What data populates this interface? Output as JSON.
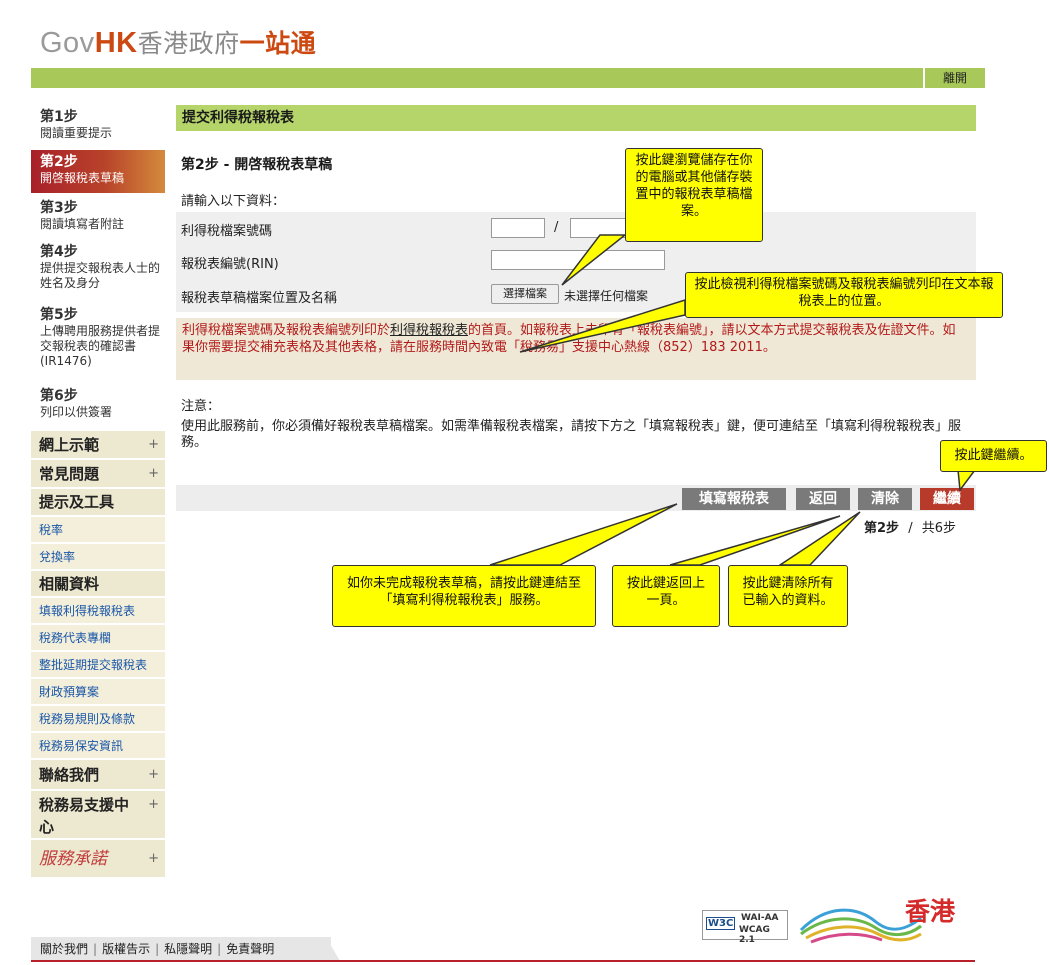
{
  "header": {
    "logo_gov": "Gov",
    "logo_hk": "HK",
    "logo_cn1": "香港政府",
    "logo_cn2": "一站通",
    "logout": "離開"
  },
  "sidebar": {
    "steps": [
      {
        "num": "第1步",
        "label": "閱讀重要提示"
      },
      {
        "num": "第2步",
        "label": "開啓報稅表草稿"
      },
      {
        "num": "第3步",
        "label": "閱讀填寫者附註"
      },
      {
        "num": "第4步",
        "label": "提供提交報稅表人士的姓名及身分"
      },
      {
        "num": "第5步",
        "label": "上傳聘用服務提供者提交報稅表的確認書 (IR1476)"
      },
      {
        "num": "第6步",
        "label": "列印以供簽署"
      }
    ],
    "menu": [
      {
        "label": "網上示範",
        "type": "big",
        "plus": "+"
      },
      {
        "label": "常見問題",
        "type": "big",
        "plus": "+"
      },
      {
        "label": "提示及工具",
        "type": "big",
        "plus": ""
      },
      {
        "label": "稅率",
        "type": "small",
        "plus": ""
      },
      {
        "label": "兌換率",
        "type": "small",
        "plus": ""
      },
      {
        "label": "相關資料",
        "type": "big",
        "plus": ""
      },
      {
        "label": "填報利得稅報稅表",
        "type": "small",
        "plus": ""
      },
      {
        "label": "稅務代表專欄",
        "type": "small",
        "plus": ""
      },
      {
        "label": "整批延期提交報稅表",
        "type": "small",
        "plus": ""
      },
      {
        "label": "財政預算案",
        "type": "small",
        "plus": ""
      },
      {
        "label": "稅務易規則及條款",
        "type": "small",
        "plus": ""
      },
      {
        "label": "稅務易保安資訊",
        "type": "small",
        "plus": ""
      },
      {
        "label": "聯絡我們",
        "type": "big",
        "plus": "+"
      },
      {
        "label": "稅務易支援中心",
        "type": "big",
        "plus": "+"
      },
      {
        "label": "服務承諾",
        "type": "brand",
        "plus": "+"
      }
    ]
  },
  "main": {
    "section_title": "提交利得稅報稅表",
    "sub_title": "第2步 - 開啓報稅表草稿",
    "intro": "請輸入以下資料：",
    "fields": {
      "file_no_label": "利得稅檔案號碼",
      "slash": "/",
      "rin_label": "報稅表編號(RIN)",
      "draft_label": "報稅表草稿檔案位置及名稱",
      "choose_file": "選擇檔案",
      "no_file": "未選擇任何檔案"
    },
    "notice_pre": "利得稅檔案號碼及報稅表編號列印於",
    "notice_link": "利得稅報稅表",
    "notice_post": "的首頁。如報稅表上未印有「報稅表編號」，請以文本方式提交報稅表及佐證文件。如果你需要提交補充表格及其他表格，請在服務時間內致電「稅務易」支援中心熱線（852）183 2011。",
    "notes_heading": "注意：",
    "notes_text": "使用此服務前，你必須備好報稅表草稿檔案。如需準備報稅表檔案，請按下方之「填寫報稅表」鍵，便可連結至「填寫利得稅報稅表」服務。",
    "buttons": {
      "fill": "填寫報稅表",
      "back": "返回",
      "clear": "清除",
      "continue": "繼續"
    },
    "pager_current": "第2步",
    "pager_sep": "/",
    "pager_total": "共6步"
  },
  "callouts": {
    "browse": "按此鍵瀏覽儲存在你的電腦或其他儲存裝置中的報稅表草稿檔案。",
    "view_pos": "按此檢視利得稅檔案號碼及報稅表編號列印在文本報稅表上的位置。",
    "continue": "按此鍵繼續。",
    "fill": "如你未完成報稅表草稿，請按此鍵連結至「填寫利得稅報稅表」服務。",
    "back": "按此鍵返回上一頁。",
    "clear": "按此鍵清除所有已輸入的資料。"
  },
  "footer": {
    "links": [
      "關於我們",
      "版權告示",
      "私隱聲明",
      "免責聲明"
    ],
    "wai": "WAI-AA",
    "wcag": "WCAG 2.1",
    "w3c": "W3C",
    "brand": "香港"
  },
  "colors": {
    "green": "#a8c95a",
    "section_green": "#b5d46a",
    "active_red": "#a8202a",
    "callout_yellow": "#ffff00",
    "button_grey": "#7a7a7a",
    "button_red": "#b83a2a"
  }
}
